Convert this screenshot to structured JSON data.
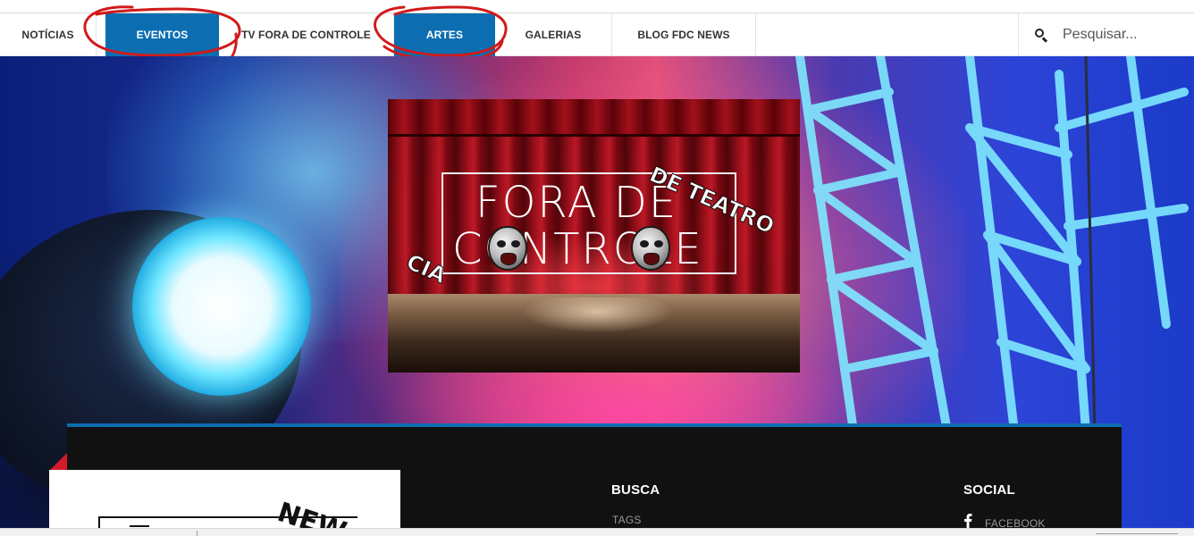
{
  "nav": {
    "items": [
      {
        "label": "NOTÍCIAS",
        "active": false
      },
      {
        "label": "EVENTOS",
        "active": true
      },
      {
        "label": "TV FORA DE CONTROLE",
        "active": false
      },
      {
        "label": "ARTES",
        "active": true
      },
      {
        "label": "GALERIAS",
        "active": false
      },
      {
        "label": "BLOG FDC NEWS",
        "active": false
      }
    ],
    "search": {
      "placeholder": "Pesquisar...",
      "icon": "search-icon"
    }
  },
  "hero": {
    "logo": {
      "line1": "FORA DE",
      "line2": "CONTROLE",
      "prefix": "CIA",
      "suffix": "DE TEATRO"
    }
  },
  "footer": {
    "card_text": "NEW",
    "busca": {
      "title": "BUSCA",
      "links": [
        "TAGS"
      ]
    },
    "social": {
      "title": "SOCIAL",
      "links": [
        {
          "label": "FACEBOOK",
          "icon": "facebook-icon"
        }
      ]
    }
  },
  "colors": {
    "accent": "#0c6eb1",
    "annotation": "#d11a1a",
    "panel": "#111111"
  }
}
